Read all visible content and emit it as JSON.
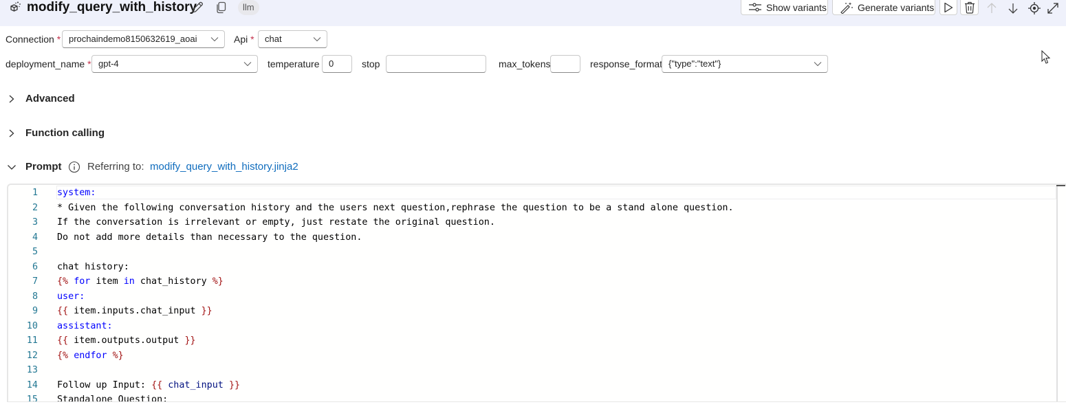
{
  "header": {
    "title": "modify_query_with_history",
    "tag": "llm",
    "buttons": {
      "show_variants": "Show variants",
      "generate_variants": "Generate variants"
    }
  },
  "params": {
    "connection": {
      "label": "Connection",
      "required": "*",
      "value": "prochaindemo8150632619_aoai"
    },
    "api": {
      "label": "Api",
      "required": "*",
      "value": "chat"
    },
    "deployment_name": {
      "label": "deployment_name",
      "required": "*",
      "value": "gpt-4"
    },
    "temperature": {
      "label": "temperature",
      "value": "0"
    },
    "stop": {
      "label": "stop",
      "value": ""
    },
    "max_tokens": {
      "label": "max_tokens",
      "value": ""
    },
    "response_format": {
      "label": "response_format",
      "value": "{\"type\":\"text\"}"
    }
  },
  "sections": {
    "advanced": "Advanced",
    "function_calling": "Function calling",
    "prompt": "Prompt",
    "referring_to_label": "Referring to:",
    "referring_to_file": "modify_query_with_history.jinja2"
  },
  "editor": {
    "lines": [
      {
        "n": "1",
        "tokens": [
          {
            "t": "system:",
            "c": "sys"
          }
        ]
      },
      {
        "n": "2",
        "tokens": [
          {
            "t": "* Given the following conversation history and the users next question,rephrase the question to be a stand alone question.",
            "c": ""
          }
        ]
      },
      {
        "n": "3",
        "tokens": [
          {
            "t": "If the conversation is irrelevant or empty, just restate the original question.",
            "c": ""
          }
        ]
      },
      {
        "n": "4",
        "tokens": [
          {
            "t": "Do not add more details than necessary to the question.",
            "c": ""
          }
        ]
      },
      {
        "n": "5",
        "tokens": []
      },
      {
        "n": "6",
        "tokens": [
          {
            "t": "chat history:",
            "c": ""
          }
        ]
      },
      {
        "n": "7",
        "tokens": [
          {
            "t": "{%",
            "c": "dl"
          },
          {
            "t": " ",
            "c": ""
          },
          {
            "t": "for",
            "c": "kw"
          },
          {
            "t": " item ",
            "c": ""
          },
          {
            "t": "in",
            "c": "kw"
          },
          {
            "t": " chat_history ",
            "c": ""
          },
          {
            "t": "%}",
            "c": "dl"
          }
        ]
      },
      {
        "n": "8",
        "tokens": [
          {
            "t": "user:",
            "c": "sys"
          }
        ]
      },
      {
        "n": "9",
        "tokens": [
          {
            "t": "{{",
            "c": "dl"
          },
          {
            "t": " item.inputs.chat_input ",
            "c": ""
          },
          {
            "t": "}}",
            "c": "dl"
          }
        ]
      },
      {
        "n": "10",
        "tokens": [
          {
            "t": "assistant:",
            "c": "sys"
          }
        ]
      },
      {
        "n": "11",
        "tokens": [
          {
            "t": "{{",
            "c": "dl"
          },
          {
            "t": " item.outputs.output ",
            "c": ""
          },
          {
            "t": "}}",
            "c": "dl"
          }
        ]
      },
      {
        "n": "12",
        "tokens": [
          {
            "t": "{%",
            "c": "dl"
          },
          {
            "t": " ",
            "c": ""
          },
          {
            "t": "endfor",
            "c": "kw"
          },
          {
            "t": " ",
            "c": ""
          },
          {
            "t": "%}",
            "c": "dl"
          }
        ]
      },
      {
        "n": "13",
        "tokens": []
      },
      {
        "n": "14",
        "tokens": [
          {
            "t": "Follow up Input: ",
            "c": ""
          },
          {
            "t": "{{",
            "c": "dl"
          },
          {
            "t": " chat_input ",
            "c": "vr"
          },
          {
            "t": "}}",
            "c": "dl"
          }
        ]
      },
      {
        "n": "15",
        "tokens": [
          {
            "t": "Standalone Question:",
            "c": ""
          }
        ]
      }
    ]
  },
  "icons": {
    "node": "llm-node-icon",
    "edit": "pencil-icon",
    "copy": "copy-icon",
    "show_variants": "sliders-icon",
    "generate_variants": "magic-wand-icon",
    "run": "play-icon",
    "delete": "trash-icon",
    "move_up": "arrow-up-icon",
    "move_down": "arrow-down-icon",
    "locate": "target-icon",
    "expand": "expand-icon"
  },
  "colors": {
    "header_bg": "#eff1fb",
    "link": "#0f6cbd",
    "required": "#c4314b",
    "keyword": "#0000ff",
    "delimiter": "#a31515",
    "line_number": "#237893"
  }
}
